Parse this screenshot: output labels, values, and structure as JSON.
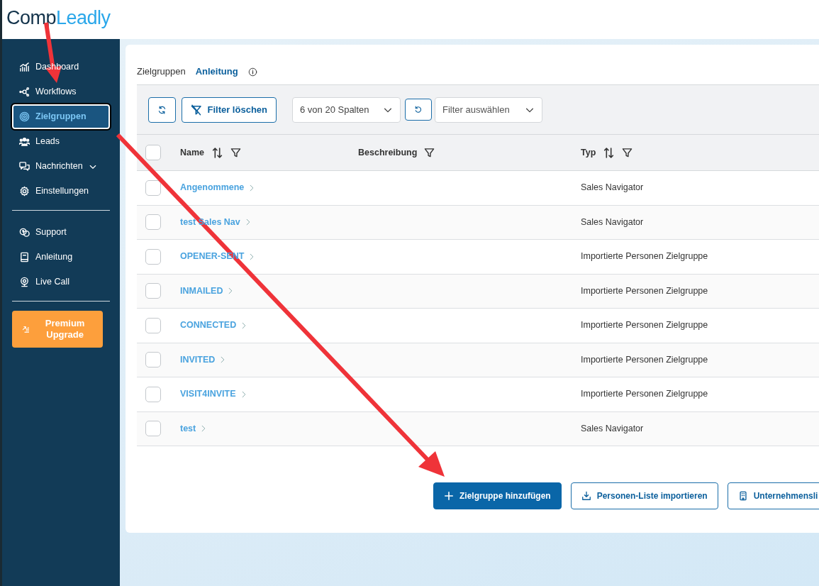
{
  "logo": {
    "part1": "Comp",
    "part2": "Leadly"
  },
  "sidebar": {
    "groups": [
      {
        "items": [
          {
            "label": "Dashboard",
            "kind": "link",
            "selected": false
          },
          {
            "label": "Workflows",
            "kind": "link",
            "selected": false
          },
          {
            "label": "Zielgruppen",
            "kind": "link",
            "selected": true
          },
          {
            "label": "Leads",
            "kind": "link",
            "selected": false
          },
          {
            "label": "Nachrichten",
            "kind": "submenu",
            "selected": false
          },
          {
            "label": "Einstellungen",
            "kind": "link",
            "selected": false
          }
        ]
      },
      {
        "items": [
          {
            "label": "Support",
            "kind": "link",
            "selected": false
          },
          {
            "label": "Anleitung",
            "kind": "link",
            "selected": false
          },
          {
            "label": "Live Call",
            "kind": "link",
            "selected": false
          }
        ]
      }
    ],
    "upgrade_button": {
      "label": "Premium Upgrade"
    }
  },
  "breadcrumb": {
    "title": "Zielgruppen",
    "link": "Anleitung"
  },
  "toolbar": {
    "clear_filter": "Filter löschen",
    "columns_select": "6 von 20 Spalten",
    "filter_select": {
      "placeholder": "Filter auswählen"
    }
  },
  "table": {
    "select_all": {
      "checked": false
    },
    "columns": [
      {
        "label": "Name",
        "sortable": true,
        "filterable": true
      },
      {
        "label": "Beschreibung",
        "sortable": false,
        "filterable": true
      },
      {
        "label": "Typ",
        "sortable": true,
        "filterable": true
      }
    ],
    "rows": [
      {
        "name": "Angenommene",
        "description": "",
        "type": "Sales Navigator",
        "checked": false
      },
      {
        "name": "test Sales Nav",
        "type": "Sales Navigator",
        "checked": false
      },
      {
        "name": "OPENER-SENT",
        "type": "Importierte Personen Zielgruppe",
        "checked": false
      },
      {
        "name": "INMAILED",
        "type": "Importierte Personen Zielgruppe",
        "checked": false
      },
      {
        "name": "CONNECTED",
        "type": "Importierte Personen Zielgruppe",
        "checked": false
      },
      {
        "name": "INVITED",
        "type": "Importierte Personen Zielgruppe",
        "checked": false
      },
      {
        "name": "VISIT4INVITE",
        "type": "Importierte Personen Zielgruppe",
        "checked": false
      },
      {
        "name": "test",
        "type": "Sales Navigator",
        "checked": false
      }
    ]
  },
  "actions": [
    {
      "label": "Zielgruppe hinzufügen",
      "kind": "primary"
    },
    {
      "label": "Personen-Liste importieren",
      "kind": "outline"
    },
    {
      "label": "Unternehmensli",
      "kind": "outline"
    }
  ]
}
